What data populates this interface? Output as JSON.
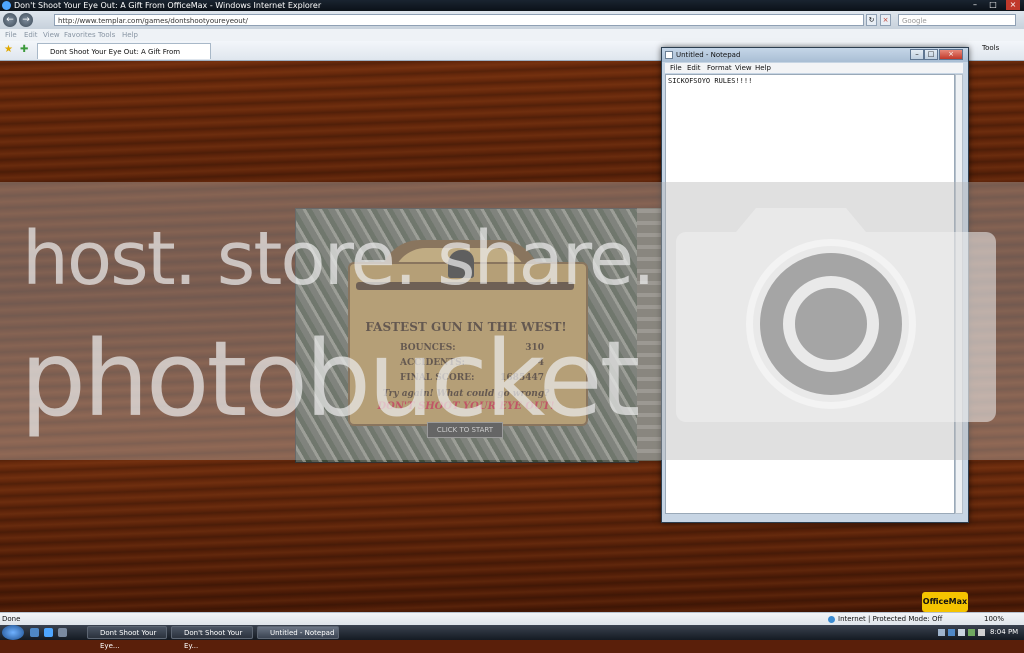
{
  "browser": {
    "title": "Don't Shoot Your Eye Out: A Gift From OfficeMax - Windows Internet Explorer",
    "address": "http://www.templar.com/games/dontshootyoureyeout/",
    "search_placeholder": "Google",
    "menu": [
      "File",
      "Edit",
      "View",
      "Favorites",
      "Tools",
      "Help"
    ],
    "tab_label": "Dont Shoot Your Eye Out: A Gift From OfficeMax",
    "tools_label": "Tools",
    "status_text": "Done",
    "zone_text": "Internet | Protected Mode: Off",
    "zoom": "100%"
  },
  "game": {
    "title": "FASTEST GUN IN THE WEST!",
    "bounces_label": "BOUNCES:",
    "bounces_value": "310",
    "accidents_label": "ACCIDENTS:",
    "accidents_value": "4",
    "final_score_label": "FINAL SCORE:",
    "final_score_value": "1685447",
    "prompt": "Try again! What could go wrong?",
    "brand": "DON'T SHOOT YOUR EYE OUT!",
    "start_label": "CLICK TO START"
  },
  "notepad": {
    "title": "Untitled - Notepad",
    "menu": [
      "File",
      "Edit",
      "Format",
      "View",
      "Help"
    ],
    "content": "SICKOFSOYO RULES!!!!"
  },
  "watermark": {
    "line1": "host. store. share.",
    "line2": "photobucket"
  },
  "page": {
    "logo": "OfficeMax"
  },
  "taskbar": {
    "buttons": [
      "Dont Shoot Your Eye...",
      "Don't Shoot Your Ey...",
      "Untitled - Notepad"
    ],
    "clock": "8:04 PM"
  },
  "colors": {
    "wood": "#5a1f0a",
    "sign": "#b58f4b",
    "brand_red": "#c8102e",
    "officemax_yellow": "#f5c400"
  }
}
